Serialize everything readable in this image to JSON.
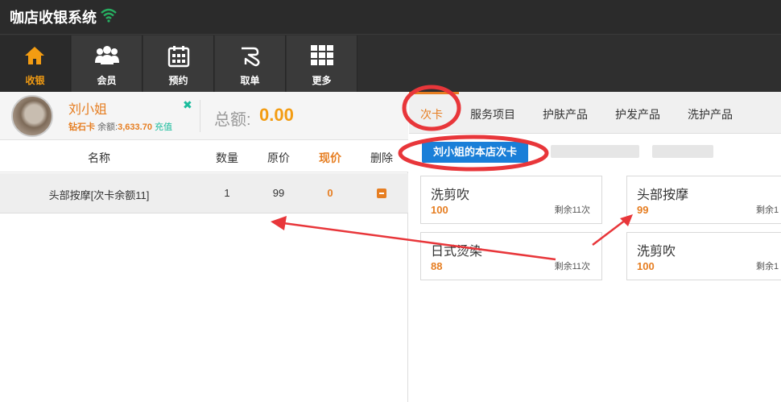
{
  "app": {
    "title": "咖店收银系统"
  },
  "nav": [
    {
      "label": "收银",
      "icon": "home-icon",
      "active": true
    },
    {
      "label": "会员",
      "icon": "members-icon",
      "active": false
    },
    {
      "label": "预约",
      "icon": "calendar-icon",
      "active": false
    },
    {
      "label": "取单",
      "icon": "hand-icon",
      "active": false
    },
    {
      "label": "更多",
      "icon": "grid-icon",
      "active": false
    }
  ],
  "member": {
    "name": "刘小姐",
    "card_type": "钻石卡",
    "balance_label": "余额:",
    "balance": "3,633.70",
    "recharge": "充值"
  },
  "total": {
    "label": "总额:",
    "value": "0.00"
  },
  "cart": {
    "headers": {
      "name": "名称",
      "qty": "数量",
      "orig": "原价",
      "current": "现价",
      "del": "删除"
    },
    "rows": [
      {
        "name": "头部按摩[次卡余额11]",
        "qty": "1",
        "orig": "99",
        "current": "0"
      }
    ]
  },
  "tabs": [
    "次卡",
    "服务项目",
    "护肤产品",
    "护发产品",
    "洗护产品"
  ],
  "active_tab": "次卡",
  "sub_tab": "刘小姐的本店次卡",
  "products": [
    {
      "name": "洗剪吹",
      "price": "100",
      "remain": "剩余11次"
    },
    {
      "name": "头部按摩",
      "price": "99",
      "remain": "剩余1"
    },
    {
      "name": "日式烫染",
      "price": "88",
      "remain": "剩余11次"
    },
    {
      "name": "洗剪吹",
      "price": "100",
      "remain": "剩余1"
    }
  ],
  "colors": {
    "accent": "#e67e22",
    "blue": "#1a7fd8",
    "annotation": "#e8363a",
    "dark": "#2b2b2b"
  }
}
